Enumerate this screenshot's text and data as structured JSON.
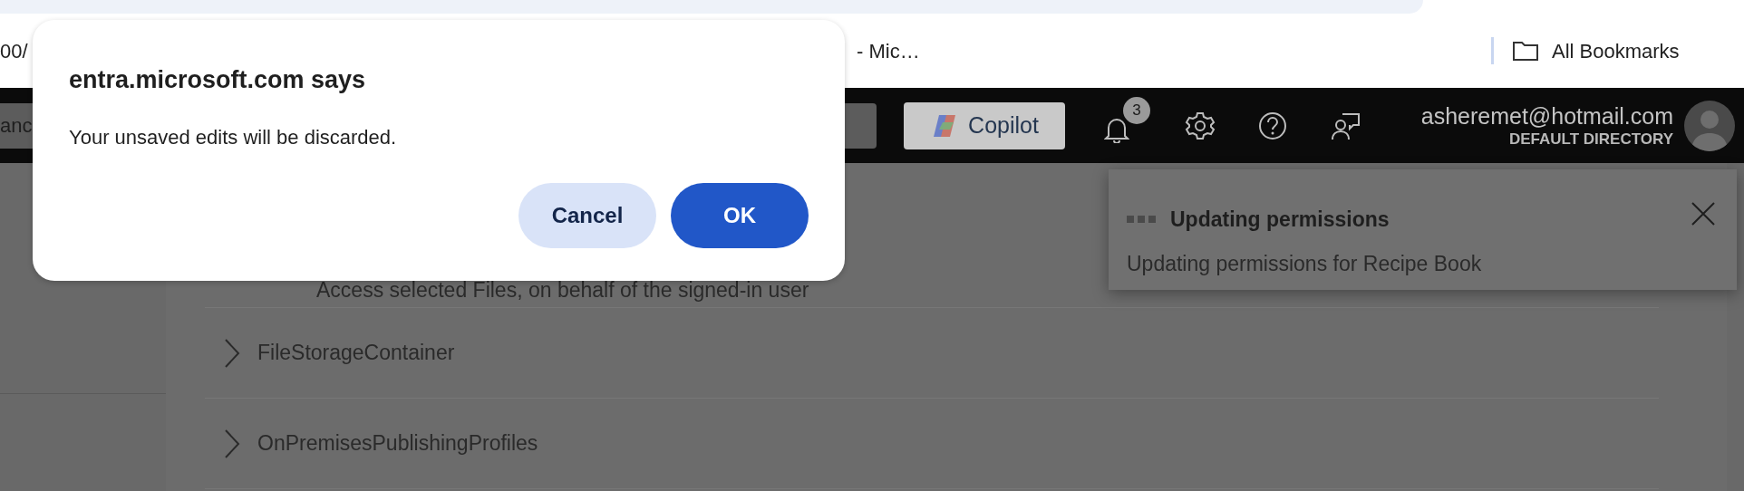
{
  "bookmarks_bar": {
    "left_fragment": "00/",
    "bookmark": "- Mic…",
    "all_bookmarks": "All Bookmarks"
  },
  "header": {
    "search_value": "anc",
    "copilot": "Copilot",
    "notifications_count": "3",
    "user_email": "asheremet@hotmail.com",
    "directory": "DEFAULT DIRECTORY"
  },
  "permissions": [
    {
      "kind": "description",
      "text": "Access selected Files, on behalf of the signed-in user"
    },
    {
      "kind": "group",
      "text": "FileStorageContainer",
      "expanded": false
    },
    {
      "kind": "group",
      "text": "OnPremisesPublishingProfiles",
      "expanded": false
    }
  ],
  "toast": {
    "title": "Updating permissions",
    "message": "Updating permissions for Recipe Book"
  },
  "dialog": {
    "title": "entra.microsoft.com says",
    "message": "Your unsaved edits will be discarded.",
    "buttons": [
      {
        "label": "Cancel",
        "kind": "secondary"
      },
      {
        "label": "OK",
        "kind": "primary"
      }
    ]
  }
}
